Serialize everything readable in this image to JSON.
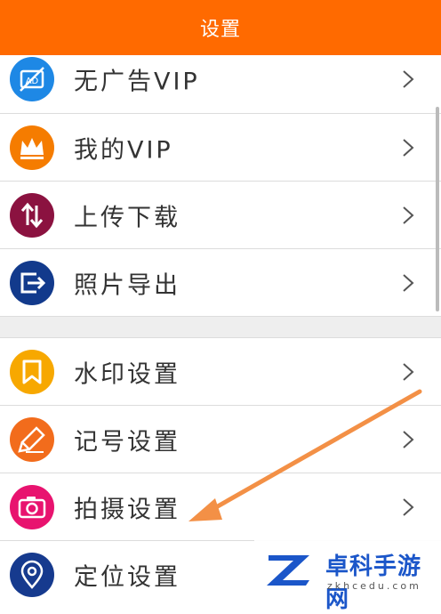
{
  "header": {
    "title": "设置"
  },
  "menu_group_1": [
    {
      "label": "无广告VIP",
      "icon": "no-ads-icon",
      "color": "#1e88e5"
    },
    {
      "label": "我的VIP",
      "icon": "crown-icon",
      "color": "#f57c00"
    },
    {
      "label": "上传下载",
      "icon": "upload-download-icon",
      "color": "#8b1240"
    },
    {
      "label": "照片导出",
      "icon": "export-icon",
      "color": "#123a8c"
    }
  ],
  "menu_group_2": [
    {
      "label": "水印设置",
      "icon": "bookmark-icon",
      "color": "#f7a800"
    },
    {
      "label": "记号设置",
      "icon": "marker-icon",
      "color": "#f26c1c"
    },
    {
      "label": "拍摄设置",
      "icon": "camera-icon",
      "color": "#e8136f"
    },
    {
      "label": "定位设置",
      "icon": "location-pin-icon",
      "color": "#163a8e"
    }
  ],
  "watermark": {
    "name": "卓科手游网",
    "url": "zkhcedu.com"
  },
  "colors": {
    "header": "#ff6a00",
    "arrow": "#f39046"
  }
}
